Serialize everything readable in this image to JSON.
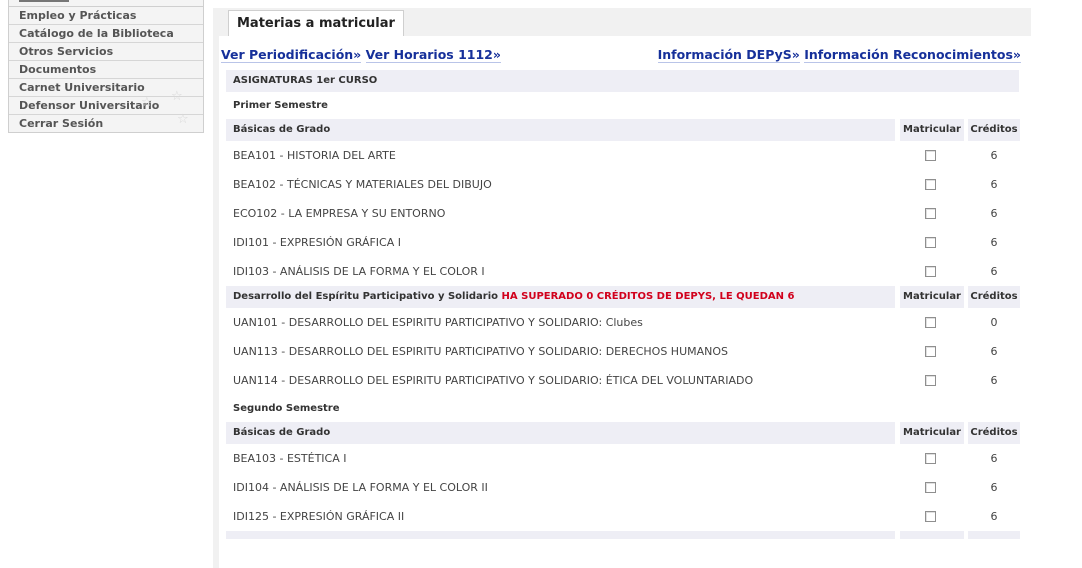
{
  "sidebar": {
    "items": [
      {
        "label": "Empleo y Prácticas"
      },
      {
        "label": "Catálogo de la Biblioteca"
      },
      {
        "label": "Otros Servicios"
      },
      {
        "label": "Documentos"
      },
      {
        "label": "Carnet Universitario"
      },
      {
        "label": "Defensor Universitario"
      },
      {
        "label": "Cerrar Sesión"
      }
    ]
  },
  "tab": {
    "label": "Materias a matricular"
  },
  "links": {
    "periodificacion": "Ver Periodificación»",
    "horarios": "Ver Horarios 1112»",
    "depys": "Información DEPyS»",
    "reconocimientos": "Información Reconocimientos»"
  },
  "course_title": "ASIGNATURAS 1er CURSO",
  "semester1": {
    "label": "Primer Semestre",
    "group1": {
      "name": "Básicas de Grado",
      "col_matricular": "Matricular",
      "col_creditos": "Créditos",
      "subjects": [
        {
          "name": "BEA101 - HISTORIA DEL ARTE",
          "credits": "6"
        },
        {
          "name": "BEA102 - TÉCNICAS Y MATERIALES DEL DIBUJO",
          "credits": "6"
        },
        {
          "name": "ECO102 - LA EMPRESA Y SU ENTORNO",
          "credits": "6"
        },
        {
          "name": "IDI101 - EXPRESIÓN GRÁFICA I",
          "credits": "6"
        },
        {
          "name": "IDI103 - ANÁLISIS DE LA FORMA Y EL COLOR I",
          "credits": "6"
        }
      ]
    },
    "group2": {
      "name": "Desarrollo del Espíritu Participativo y Solidario",
      "warning": "HA SUPERADO 0 CRÉDITOS DE DEPYS, LE QUEDAN 6",
      "col_matricular": "Matricular",
      "col_creditos": "Créditos",
      "subjects": [
        {
          "name": "UAN101 - DESARROLLO DEL ESPIRITU PARTICIPATIVO Y SOLIDARIO: Clubes",
          "credits": "0"
        },
        {
          "name": "UAN113 - DESARROLLO DEL ESPIRITU PARTICIPATIVO Y SOLIDARIO: DERECHOS HUMANOS",
          "credits": "6"
        },
        {
          "name": "UAN114 - DESARROLLO DEL ESPIRITU PARTICIPATIVO Y SOLIDARIO: ÉTICA DEL VOLUNTARIADO",
          "credits": "6"
        }
      ]
    }
  },
  "semester2": {
    "label": "Segundo Semestre",
    "group1": {
      "name": "Básicas de Grado",
      "col_matricular": "Matricular",
      "col_creditos": "Créditos",
      "subjects": [
        {
          "name": "BEA103 - ESTÉTICA I",
          "credits": "6"
        },
        {
          "name": "IDI104 - ANÁLISIS DE LA FORMA Y EL COLOR II",
          "credits": "6"
        },
        {
          "name": "IDI125 - EXPRESIÓN GRÁFICA II",
          "credits": "6"
        }
      ]
    }
  },
  "colors": {
    "link": "#16309a",
    "warning": "#d1001c",
    "header_bg": "#eeeef5"
  }
}
